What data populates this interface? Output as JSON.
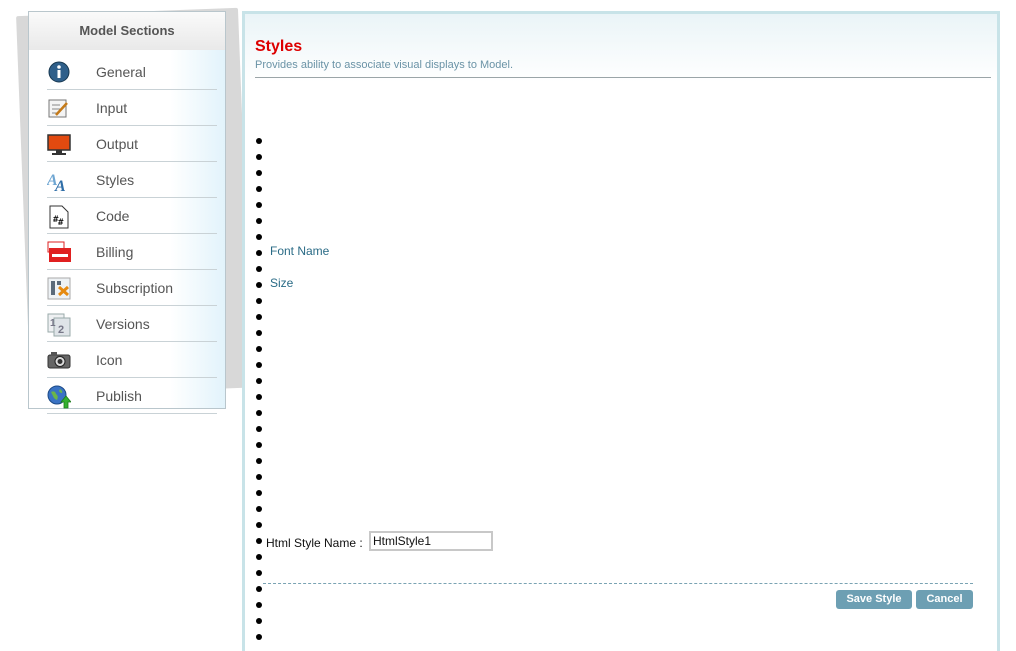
{
  "sidebar": {
    "title": "Model Sections",
    "items": [
      {
        "label": "General"
      },
      {
        "label": "Input"
      },
      {
        "label": "Output"
      },
      {
        "label": "Styles"
      },
      {
        "label": "Code"
      },
      {
        "label": "Billing"
      },
      {
        "label": "Subscription"
      },
      {
        "label": "Versions"
      },
      {
        "label": "Icon"
      },
      {
        "label": "Publish"
      }
    ]
  },
  "main": {
    "title": "Styles",
    "subtitle": "Provides ability to associate visual displays to Model.",
    "field_links": [
      "Font Name",
      "Size"
    ],
    "style_name_label": "Html Style Name :",
    "style_name_value": "HtmlStyle1",
    "save_label": "Save Style",
    "cancel_label": "Cancel"
  },
  "colors": {
    "title_red": "#dd0000",
    "button_blue": "#6d9fb3",
    "panel_border": "#c8e3e8",
    "link_teal": "#2a6b86"
  }
}
